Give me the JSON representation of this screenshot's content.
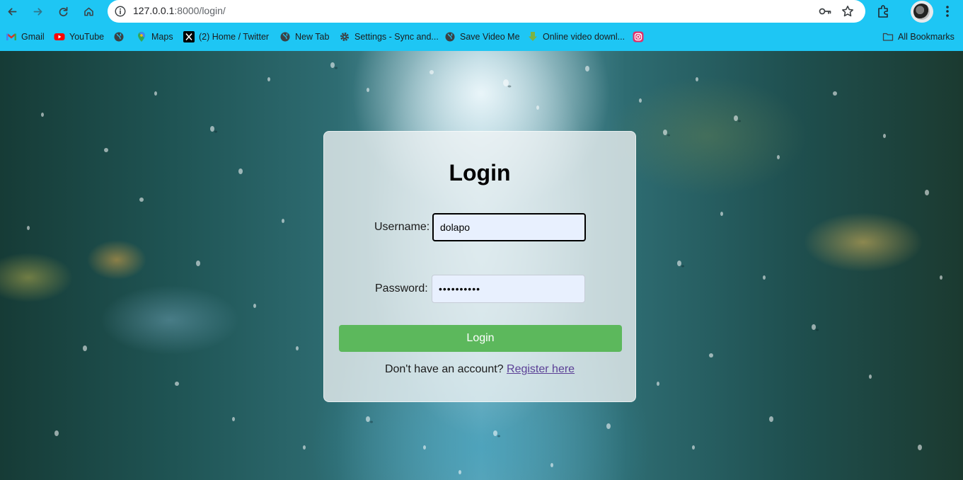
{
  "browser": {
    "url_host": "127.0.0.1",
    "url_path": ":8000/login/",
    "bookmarks": [
      {
        "label": "Gmail",
        "icon": "gmail-icon"
      },
      {
        "label": "YouTube",
        "icon": "youtube-icon"
      },
      {
        "label": "",
        "icon": "globe-icon"
      },
      {
        "label": "Maps",
        "icon": "maps-icon"
      },
      {
        "label": "(2) Home / Twitter",
        "icon": "x-icon"
      },
      {
        "label": "New Tab",
        "icon": "globe-icon"
      },
      {
        "label": "Settings - Sync and...",
        "icon": "gear-icon"
      },
      {
        "label": "Save Video Me",
        "icon": "globe-icon"
      },
      {
        "label": "Online video downl...",
        "icon": "download-icon"
      },
      {
        "label": "",
        "icon": "instagram-icon"
      }
    ],
    "all_bookmarks_label": "All Bookmarks"
  },
  "login": {
    "title": "Login",
    "username_label": "Username:",
    "username_value": "dolapo",
    "password_label": "Password:",
    "password_value": "••••••••••",
    "submit_label": "Login",
    "register_prompt": "Don't have an account?",
    "register_link": "Register here"
  },
  "colors": {
    "chrome": "#1ec6f4",
    "button": "#5cb85c",
    "link": "#5b3f96",
    "input_bg": "#e8f0fe"
  }
}
